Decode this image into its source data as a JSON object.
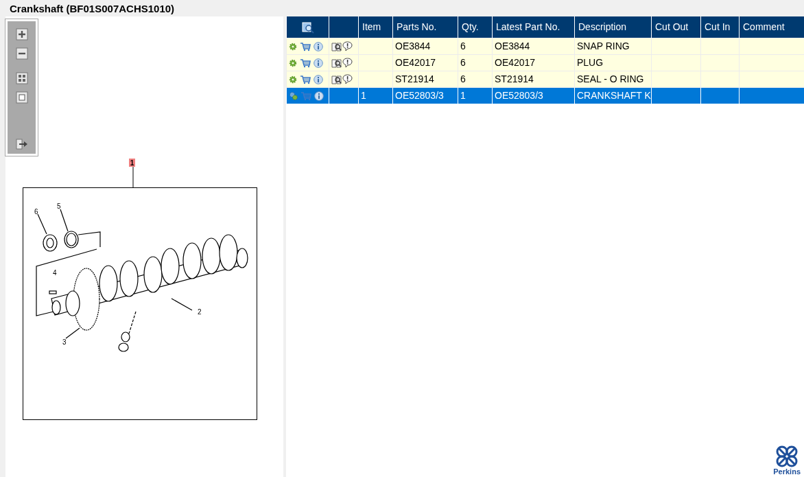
{
  "title": "Crankshaft (BF01S007ACHS1010)",
  "diagram": {
    "badge": "1",
    "callouts": [
      "2",
      "3",
      "4",
      "5",
      "6"
    ]
  },
  "table": {
    "columns": [
      "Item",
      "Parts No.",
      "Qty.",
      "Latest Part No.",
      "Description",
      "Cut Out",
      "Cut In",
      "Comment"
    ],
    "rows": [
      {
        "selected": false,
        "assembly": false,
        "documents": true,
        "parts_no": "OE3844",
        "qty": "6",
        "latest_part_no": "OE3844",
        "description": "SNAP RING"
      },
      {
        "selected": false,
        "assembly": false,
        "documents": true,
        "parts_no": "OE42017",
        "qty": "6",
        "latest_part_no": "OE42017",
        "description": "PLUG"
      },
      {
        "selected": false,
        "assembly": false,
        "documents": true,
        "parts_no": "ST21914",
        "qty": "6",
        "latest_part_no": "ST21914",
        "description": "SEAL - O RING"
      },
      {
        "selected": true,
        "assembly": true,
        "documents": false,
        "item": "1",
        "parts_no": "OE52803/3",
        "qty": "1",
        "latest_part_no": "OE52803/3",
        "description": "CRANKSHAFT K"
      }
    ]
  },
  "logo": {
    "text": "Perkins"
  }
}
